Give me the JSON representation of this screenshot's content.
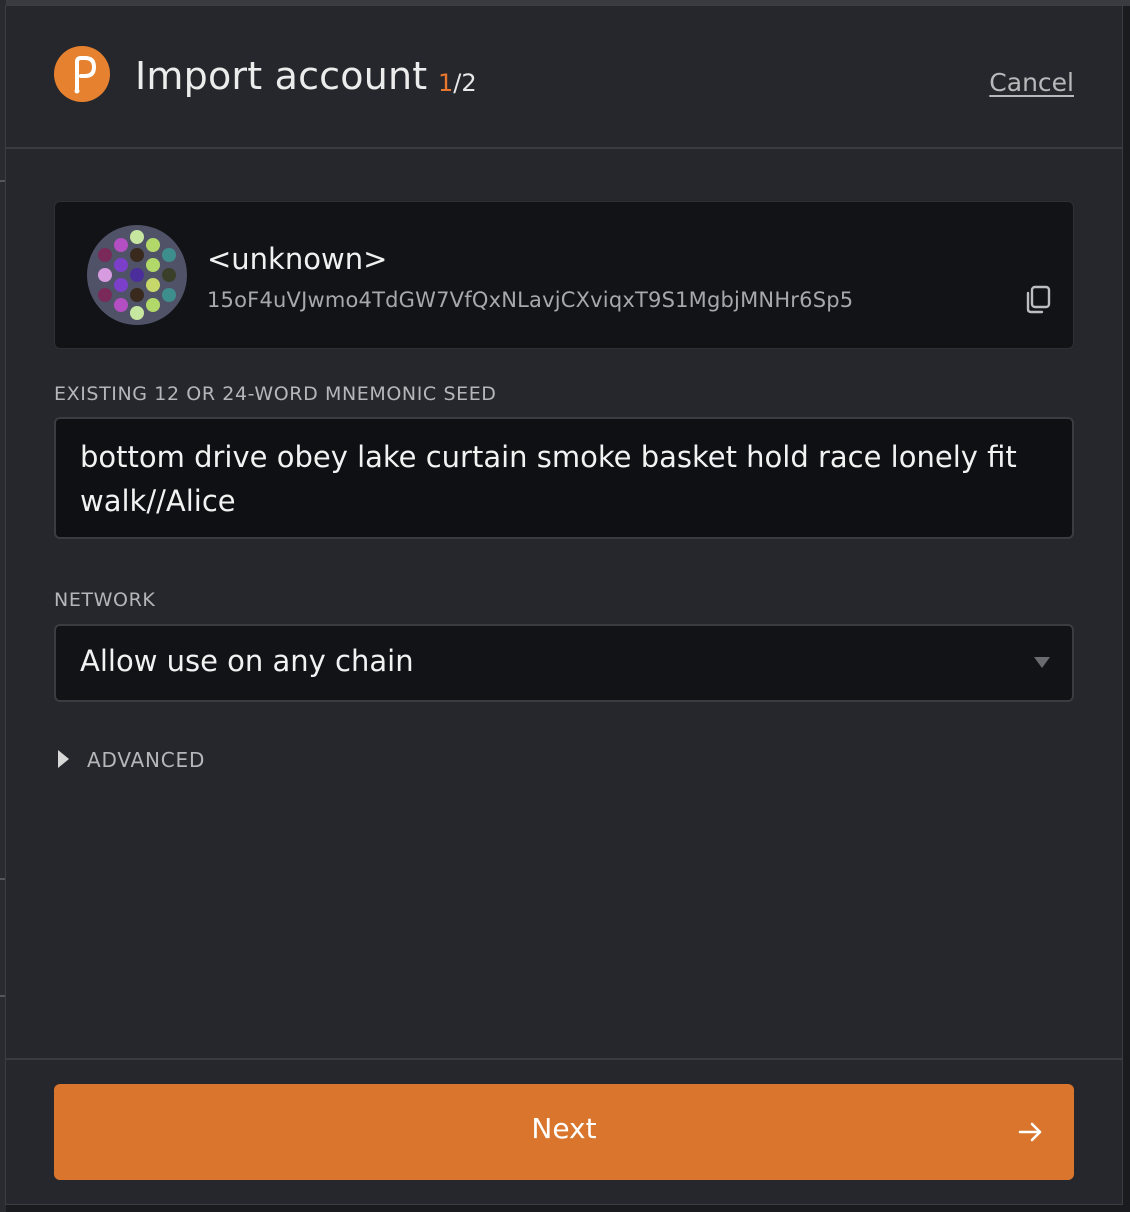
{
  "header": {
    "title": "Import account",
    "step_current": "1",
    "step_total": "/2",
    "cancel_label": "Cancel"
  },
  "account": {
    "name": "<unknown>",
    "address": "15oF4uVJwmo4TdGW7VfQxNLavjCXviqxT9S1MgbjMNHr6Sp5"
  },
  "seed": {
    "label": "EXISTING 12 OR 24-WORD MNEMONIC SEED",
    "value": "bottom drive obey lake curtain smoke basket hold race lonely fit walk//Alice"
  },
  "network": {
    "label": "NETWORK",
    "selected": "Allow use on any chain"
  },
  "advanced": {
    "label": "ADVANCED"
  },
  "footer": {
    "next_label": "Next"
  },
  "colors": {
    "accent": "#e6822f",
    "button": "#d9752c",
    "background": "#26272c"
  },
  "icons": {
    "logo": "polkadot-logo",
    "copy": "copy-icon",
    "next": "arrow-right-icon"
  }
}
